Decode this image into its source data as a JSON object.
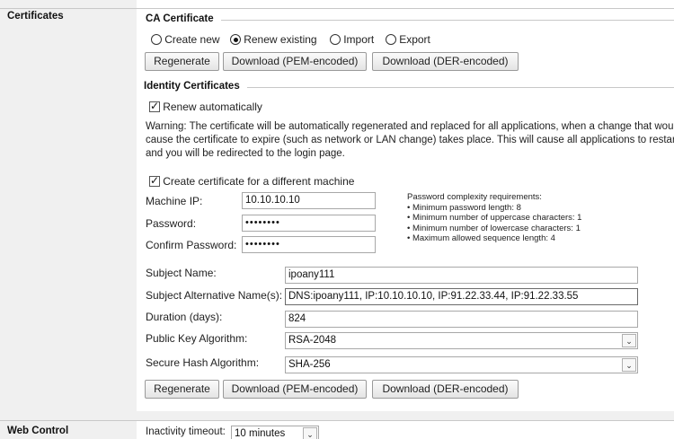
{
  "sidebar": {
    "certificates_label": "Certificates",
    "web_control_label": "Web Control"
  },
  "ca_certificate": {
    "legend": "CA Certificate",
    "options": [
      "Create new",
      "Renew existing",
      "Import",
      "Export"
    ],
    "selected": "Renew existing",
    "buttons": {
      "regenerate": "Regenerate",
      "download_pem": "Download (PEM-encoded)",
      "download_der": "Download (DER-encoded)"
    }
  },
  "identity": {
    "legend": "Identity Certificates",
    "renew_automatically_label": "Renew automatically",
    "renew_automatically_checked": true,
    "warning": "Warning: The certificate will be automatically regenerated and replaced for all applications, when a change that would cause the certificate to expire (such as network or LAN change) takes place. This will cause all applications to restart, and you will be redirected to the login page.",
    "different_machine_label": "Create certificate for a different machine",
    "different_machine_checked": true,
    "machine_ip_label": "Machine IP:",
    "machine_ip_value": "10.10.10.10",
    "password_label": "Password:",
    "password_value": "••••••••",
    "confirm_password_label": "Confirm Password:",
    "confirm_password_value": "••••••••",
    "password_requirements": {
      "title": "Password complexity requirements:",
      "items": [
        "• Minimum password length: 8",
        "• Minimum number of uppercase characters: 1",
        "• Minimum number of lowercase characters: 1",
        "• Maximum allowed sequence length: 4"
      ]
    },
    "subject_name_label": "Subject Name:",
    "subject_name_value": "ipoany111",
    "subject_alt_label": "Subject Alternative Name(s):",
    "subject_alt_value": "DNS:ipoany111, IP:10.10.10.10, IP:91.22.33.44, IP:91.22.33.55",
    "duration_label": "Duration (days):",
    "duration_value": "824",
    "public_key_label": "Public Key Algorithm:",
    "public_key_value": "RSA-2048",
    "secure_hash_label": "Secure Hash Algorithm:",
    "secure_hash_value": "SHA-256",
    "buttons": {
      "regenerate": "Regenerate",
      "download_pem": "Download (PEM-encoded)",
      "download_der": "Download (DER-encoded)"
    }
  },
  "web_control": {
    "inactivity_label": "Inactivity timeout:",
    "inactivity_value": "10 minutes"
  },
  "icons": {
    "dropdown_arrow": "chevron-down-icon",
    "cursor": "mouse-pointer-icon"
  }
}
